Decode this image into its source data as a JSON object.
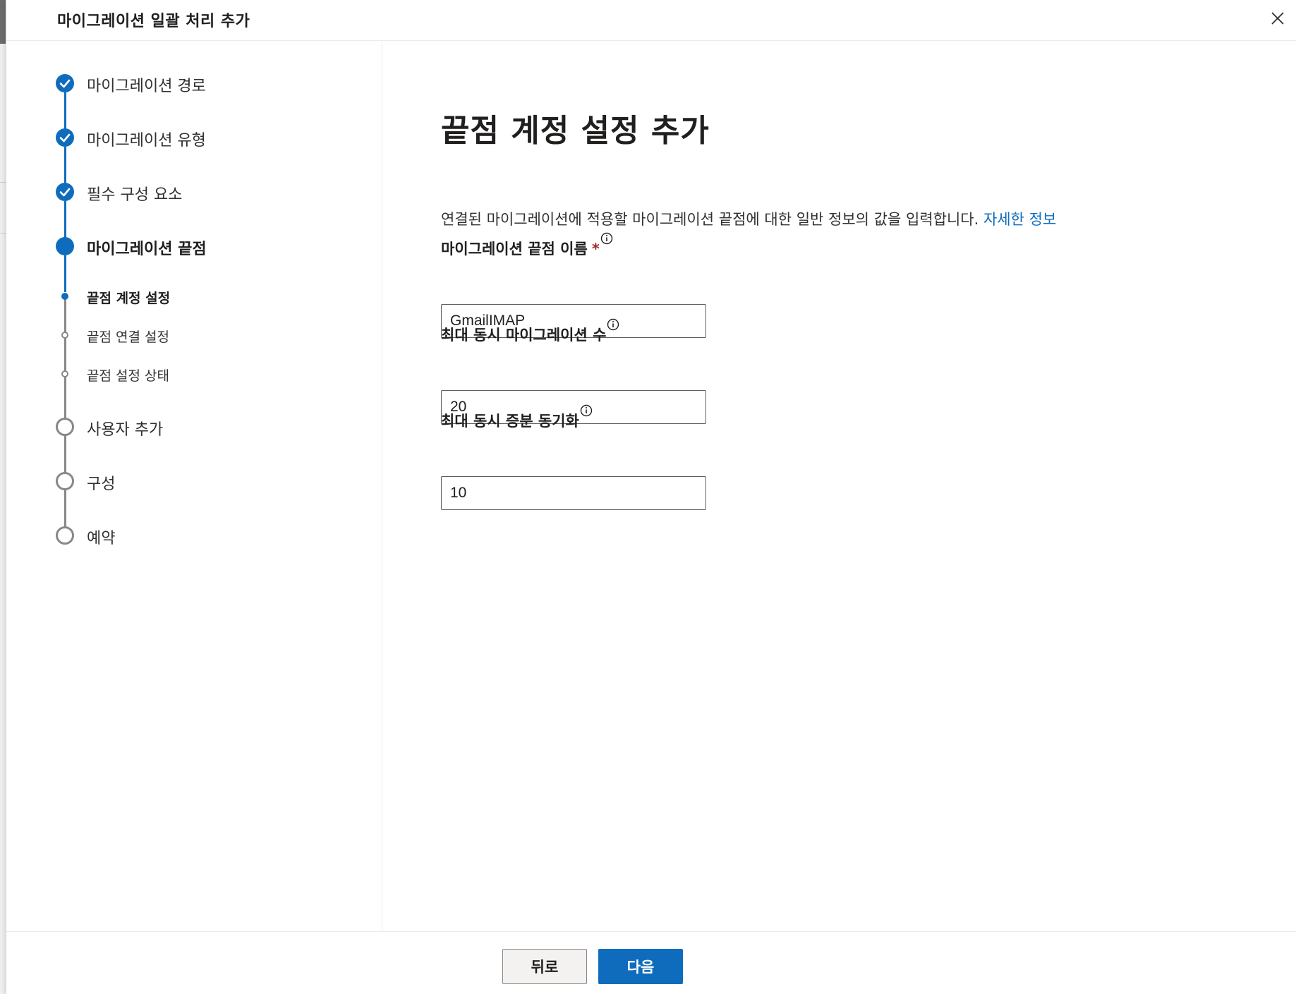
{
  "header": {
    "title": "마이그레이션 일괄 처리 추가"
  },
  "steps": [
    {
      "label": "마이그레이션 경로",
      "state": "completed"
    },
    {
      "label": "마이그레이션 유형",
      "state": "completed"
    },
    {
      "label": "필수 구성 요소",
      "state": "completed"
    },
    {
      "label": "마이그레이션 끝점",
      "state": "current"
    },
    {
      "label": "끝점 계정 설정",
      "state": "current-substep"
    },
    {
      "label": "끝점 연결 설정",
      "state": "pending-substep"
    },
    {
      "label": "끝점 설정 상태",
      "state": "pending-substep"
    },
    {
      "label": "사용자 추가",
      "state": "pending"
    },
    {
      "label": "구성",
      "state": "pending"
    },
    {
      "label": "예약",
      "state": "pending"
    }
  ],
  "main": {
    "title": "끝점 계정 설정 추가",
    "description": "연결된 마이그레이션에 적용할 마이그레이션 끝점에 대한 일반 정보의 값을 입력합니다.",
    "learn_more": "자세한 정보",
    "fields": [
      {
        "label": "마이그레이션 끝점 이름",
        "required_marker": "*",
        "value": "GmailIMAP"
      },
      {
        "label": "최대 동시 마이그레이션 수",
        "value": "20"
      },
      {
        "label": "최대 동시 증분 동기화",
        "value": "10"
      }
    ]
  },
  "footer": {
    "back_label": "뒤로",
    "next_label": "다음"
  },
  "colors": {
    "accent": "#0f6cbd",
    "pending": "#8a8886",
    "required": "#a4262c"
  }
}
